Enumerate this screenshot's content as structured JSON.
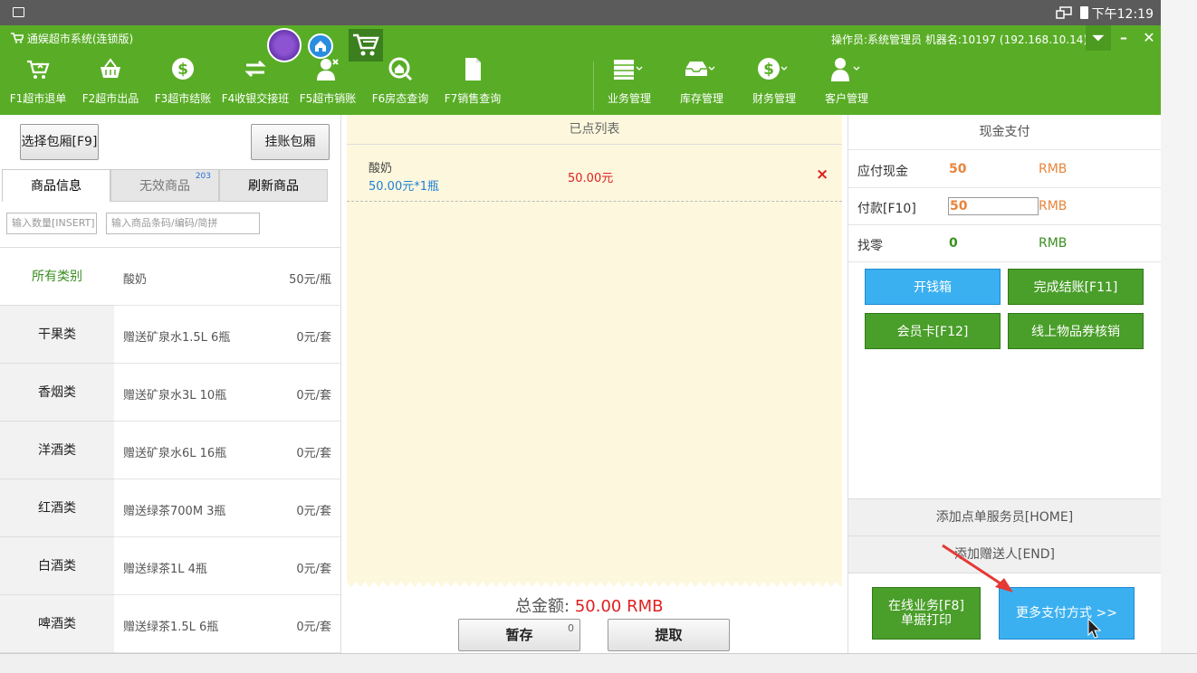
{
  "status": {
    "time": "下午12:19"
  },
  "header": {
    "title": "通娱超市系统(连锁版)",
    "operator": "操作员:系统管理员  机器名:10197 (192.168.10.14)",
    "nav": [
      {
        "label": "F1超市退单",
        "icon": "cart-return-icon"
      },
      {
        "label": "F2超市出品",
        "icon": "basket-icon"
      },
      {
        "label": "F3超市结账",
        "icon": "dollar-icon"
      },
      {
        "label": "F4收银交接班",
        "icon": "exchange-icon"
      },
      {
        "label": "F5超市销账",
        "icon": "user-cancel-icon"
      },
      {
        "label": "F6房态查询",
        "icon": "house-search-icon"
      },
      {
        "label": "F7销售查询",
        "icon": "document-icon"
      }
    ],
    "nav2": [
      {
        "label": "业务管理",
        "icon": "printer-icon"
      },
      {
        "label": "库存管理",
        "icon": "inbox-icon"
      },
      {
        "label": "财务管理",
        "icon": "dollar-icon"
      },
      {
        "label": "客户管理",
        "icon": "user-icon"
      }
    ]
  },
  "left": {
    "select_room": "选择包厢[F9]",
    "hang_room": "挂账包厢",
    "tabs": [
      "商品信息",
      "无效商品",
      "刷新商品"
    ],
    "tab_badge": "203",
    "qty_placeholder": "输入数量[INSERT]",
    "code_placeholder": "输入商品条码/编码/简拼",
    "categories": [
      "所有类别",
      "干果类",
      "香烟类",
      "洋酒类",
      "红酒类",
      "白酒类",
      "啤酒类"
    ],
    "products": [
      {
        "name": "酸奶",
        "price": "50元/瓶"
      },
      {
        "name": "赠送矿泉水1.5L 6瓶",
        "price": "0元/套"
      },
      {
        "name": "赠送矿泉水3L 10瓶",
        "price": "0元/套"
      },
      {
        "name": "赠送矿泉水6L 16瓶",
        "price": "0元/套"
      },
      {
        "name": "赠送绿茶700M 3瓶",
        "price": "0元/套"
      },
      {
        "name": "赠送绿茶1L 4瓶",
        "price": "0元/套"
      },
      {
        "name": "赠送绿茶1.5L 6瓶",
        "price": "0元/套"
      }
    ]
  },
  "mid": {
    "list_title": "已点列表",
    "item": {
      "name": "酸奶",
      "detail": "50.00元*1瓶",
      "amount": "50.00元",
      "remove": "×"
    },
    "total_label": "总金额:",
    "total_value": "50.00 RMB",
    "save_label": "暂存",
    "save_count": "0",
    "fetch_label": "提取"
  },
  "right": {
    "title": "现金支付",
    "due_label": "应付现金",
    "due_value": "50",
    "due_unit": "RMB",
    "pay_label": "付款[F10]",
    "pay_value": "50",
    "pay_unit": "RMB",
    "change_label": "找零",
    "change_value": "0",
    "change_unit": "RMB",
    "open_drawer": "开钱箱",
    "finish": "完成结账[F11]",
    "member": "会员卡[F12]",
    "online_voucher": "线上物品券核销",
    "add_waiter": "添加点单服务员[HOME]",
    "add_gift": "添加赠送人[END]",
    "online_print_1": "在线业务[F8]",
    "online_print_2": "单据打印",
    "more_pay": "更多支付方式 >>"
  },
  "colors": {
    "green": "#59ad26",
    "blue": "#3bb0f0",
    "orange": "#e8843a",
    "red": "#e02020"
  }
}
